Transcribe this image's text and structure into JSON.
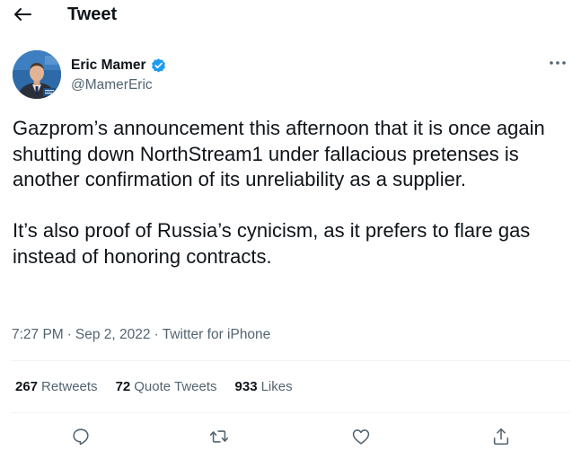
{
  "header": {
    "title": "Tweet",
    "back_icon": "arrow-left-icon"
  },
  "author": {
    "name": "Eric Mamer",
    "handle": "@MamerEric",
    "verified": true,
    "verified_color": "#1d9bf0"
  },
  "tweet": {
    "paragraphs": [
      "Gazprom’s announcement this afternoon that it is once again shutting down NorthStream1 under fallacious pretenses is another confirmation of its unreliability as a supplier.",
      "It’s also proof of Russia’s cynicism, as it prefers to flare gas instead of honoring contracts."
    ],
    "time": "7:27 PM",
    "date": "Sep 2, 2022",
    "source": "Twitter for iPhone",
    "separator": "·"
  },
  "stats": {
    "retweets_count": "267",
    "retweets_label": "Retweets",
    "quotes_count": "72",
    "quotes_label": "Quote Tweets",
    "likes_count": "933",
    "likes_label": "Likes"
  },
  "actions": {
    "reply_icon": "reply-icon",
    "retweet_icon": "retweet-icon",
    "like_icon": "heart-icon",
    "share_icon": "share-icon"
  },
  "colors": {
    "text": "#0f1419",
    "secondary": "#536471",
    "divider": "#eff3f4",
    "verified": "#1d9bf0"
  }
}
